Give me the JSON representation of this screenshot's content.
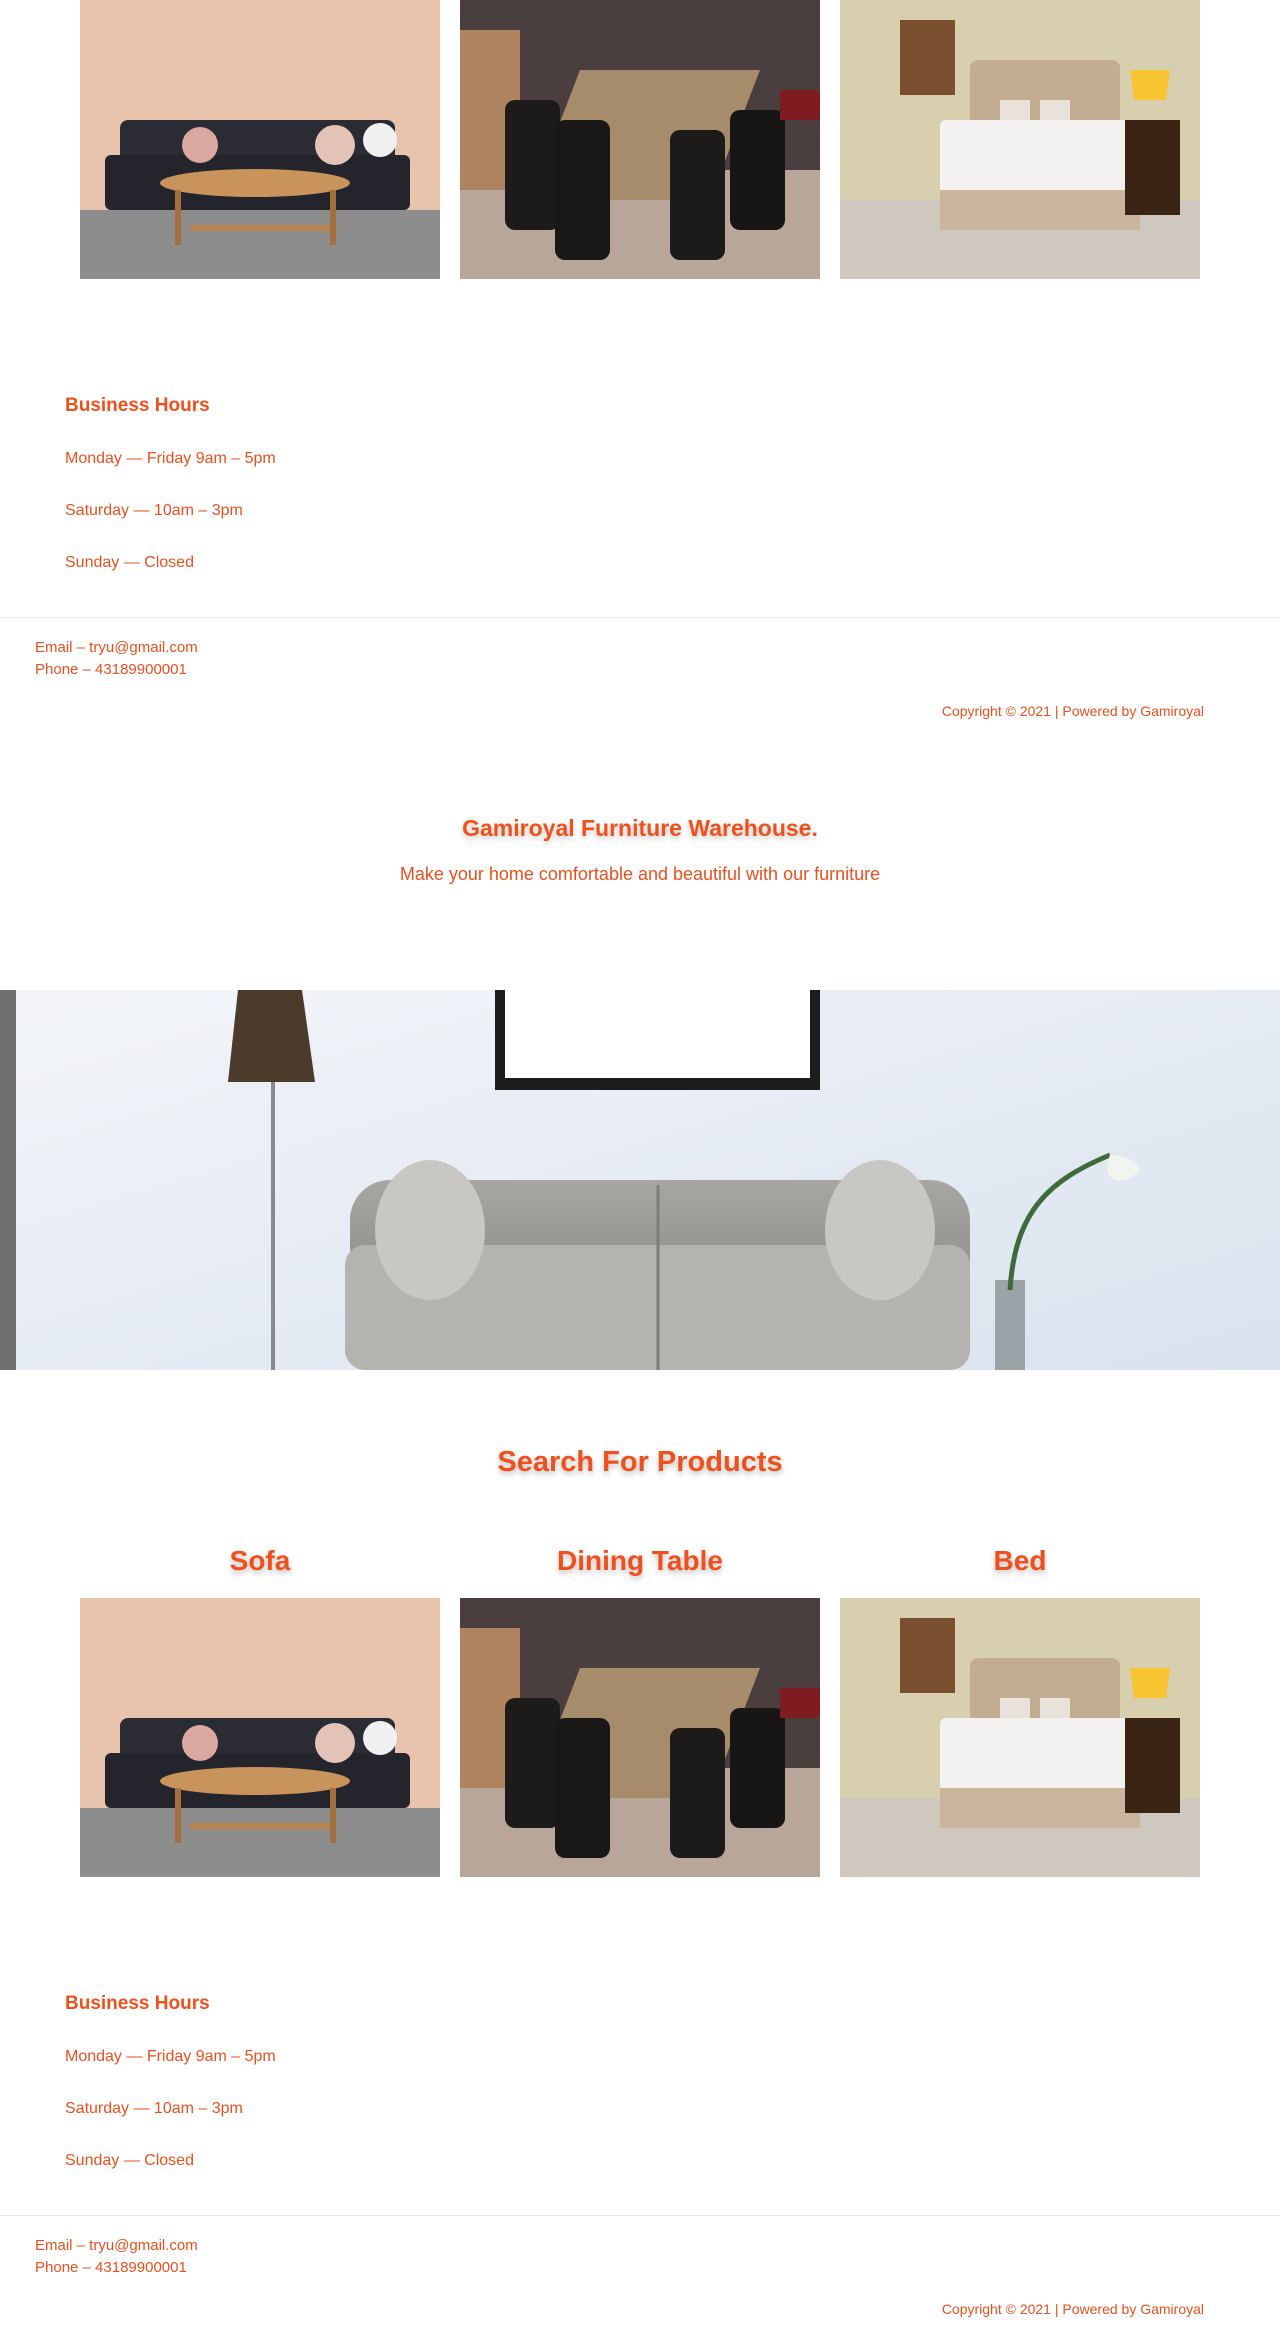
{
  "products": [
    {
      "name": "Sofa",
      "image": "sofa-photo"
    },
    {
      "name": "Dining Table",
      "image": "dining-table-photo"
    },
    {
      "name": "Bed",
      "image": "bed-photo"
    }
  ],
  "business_hours": {
    "title": "Business Hours",
    "lines": [
      "Monday — Friday 9am – 5pm",
      "Saturday — 10am – 3pm",
      "Sunday — Closed"
    ]
  },
  "contact": {
    "email": "Email – tryu@gmail.com",
    "phone": "Phone – 43189900001"
  },
  "footer": {
    "copyright": "Copyright © 2021 | Powered by Gamiroyal"
  },
  "hero": {
    "title": "Gamiroyal Furniture Warehouse.",
    "subtitle": "Make your home comfortable and beautiful with our furniture",
    "banner_image": "living-room-sofa-banner"
  },
  "search": {
    "title": "Search For Products"
  },
  "colors": {
    "accent": "#f0501c",
    "text": "#e8501e",
    "background": "#ffffff"
  }
}
